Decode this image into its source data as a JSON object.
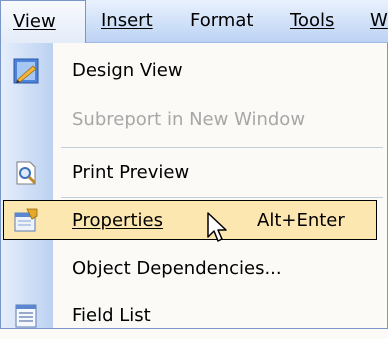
{
  "menubar": {
    "items": [
      {
        "label": "View",
        "open": true
      },
      {
        "label": "Insert"
      },
      {
        "label": "Format"
      },
      {
        "label": "Tools"
      },
      {
        "label": "W"
      }
    ]
  },
  "menu": {
    "items": [
      {
        "label": "Design View",
        "icon": "design-view-icon"
      },
      {
        "label": "Subreport in New Window",
        "disabled": true
      },
      {
        "label": "Print Preview",
        "icon": "print-preview-icon"
      },
      {
        "label": "Properties",
        "shortcut": "Alt+Enter",
        "highlighted": true,
        "icon": "properties-icon"
      },
      {
        "label": "Object Dependencies...",
        "icon": null
      },
      {
        "label": "Field List",
        "icon": "field-list-icon"
      }
    ]
  },
  "colors": {
    "menubar_top": "#eaf1fd",
    "menubar_bottom": "#bdd2f3",
    "highlight": "#fde7b1",
    "disabled_text": "#a7a7a7",
    "gutter": "#bcd1f1"
  }
}
